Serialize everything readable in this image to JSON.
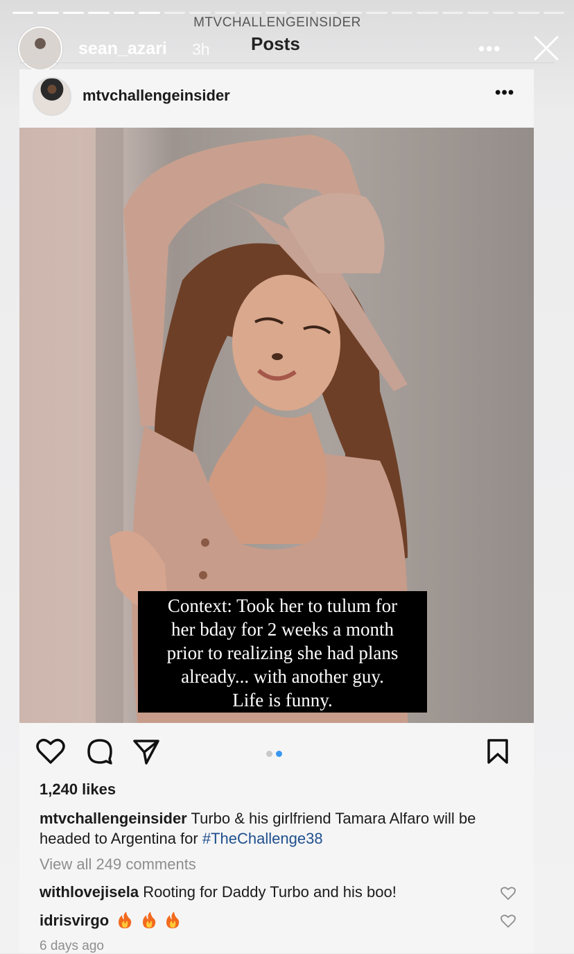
{
  "screen": {
    "subtitle": "MTVCHALLENGEINSIDER",
    "title": "Posts"
  },
  "story": {
    "username": "sean_azari",
    "time": "3h",
    "more": "•••"
  },
  "post": {
    "username": "mtvchallengeinsider",
    "more": "•••",
    "overlay_text": [
      "Context: Took her to tulum for",
      "her bday for 2 weeks a month",
      "prior to realizing she had plans",
      "already... with another guy.",
      "Life is funny."
    ],
    "likes": "1,240 likes",
    "caption_user": "mtvchallengeinsider",
    "caption_text": "Turbo & his girlfriend Tamara Alfaro will be headed to Argentina for",
    "caption_hashtag": "#TheChallenge38",
    "view_all": "View all 249 comments",
    "comments": [
      {
        "user": "withlovejisela",
        "text": "Rooting for Daddy Turbo and his boo!"
      },
      {
        "user": "idrisvirgo",
        "text": ""
      }
    ],
    "time_ago": "6 days ago",
    "carousel": {
      "count": 2,
      "active": 2
    }
  },
  "colors": {
    "accent": "#3897f0",
    "hashtag": "#1e4f8c",
    "muted": "#8e8e8e"
  },
  "icons": [
    "heart-icon",
    "comment-icon",
    "share-icon",
    "bookmark-icon",
    "close-icon",
    "fire-icon"
  ]
}
